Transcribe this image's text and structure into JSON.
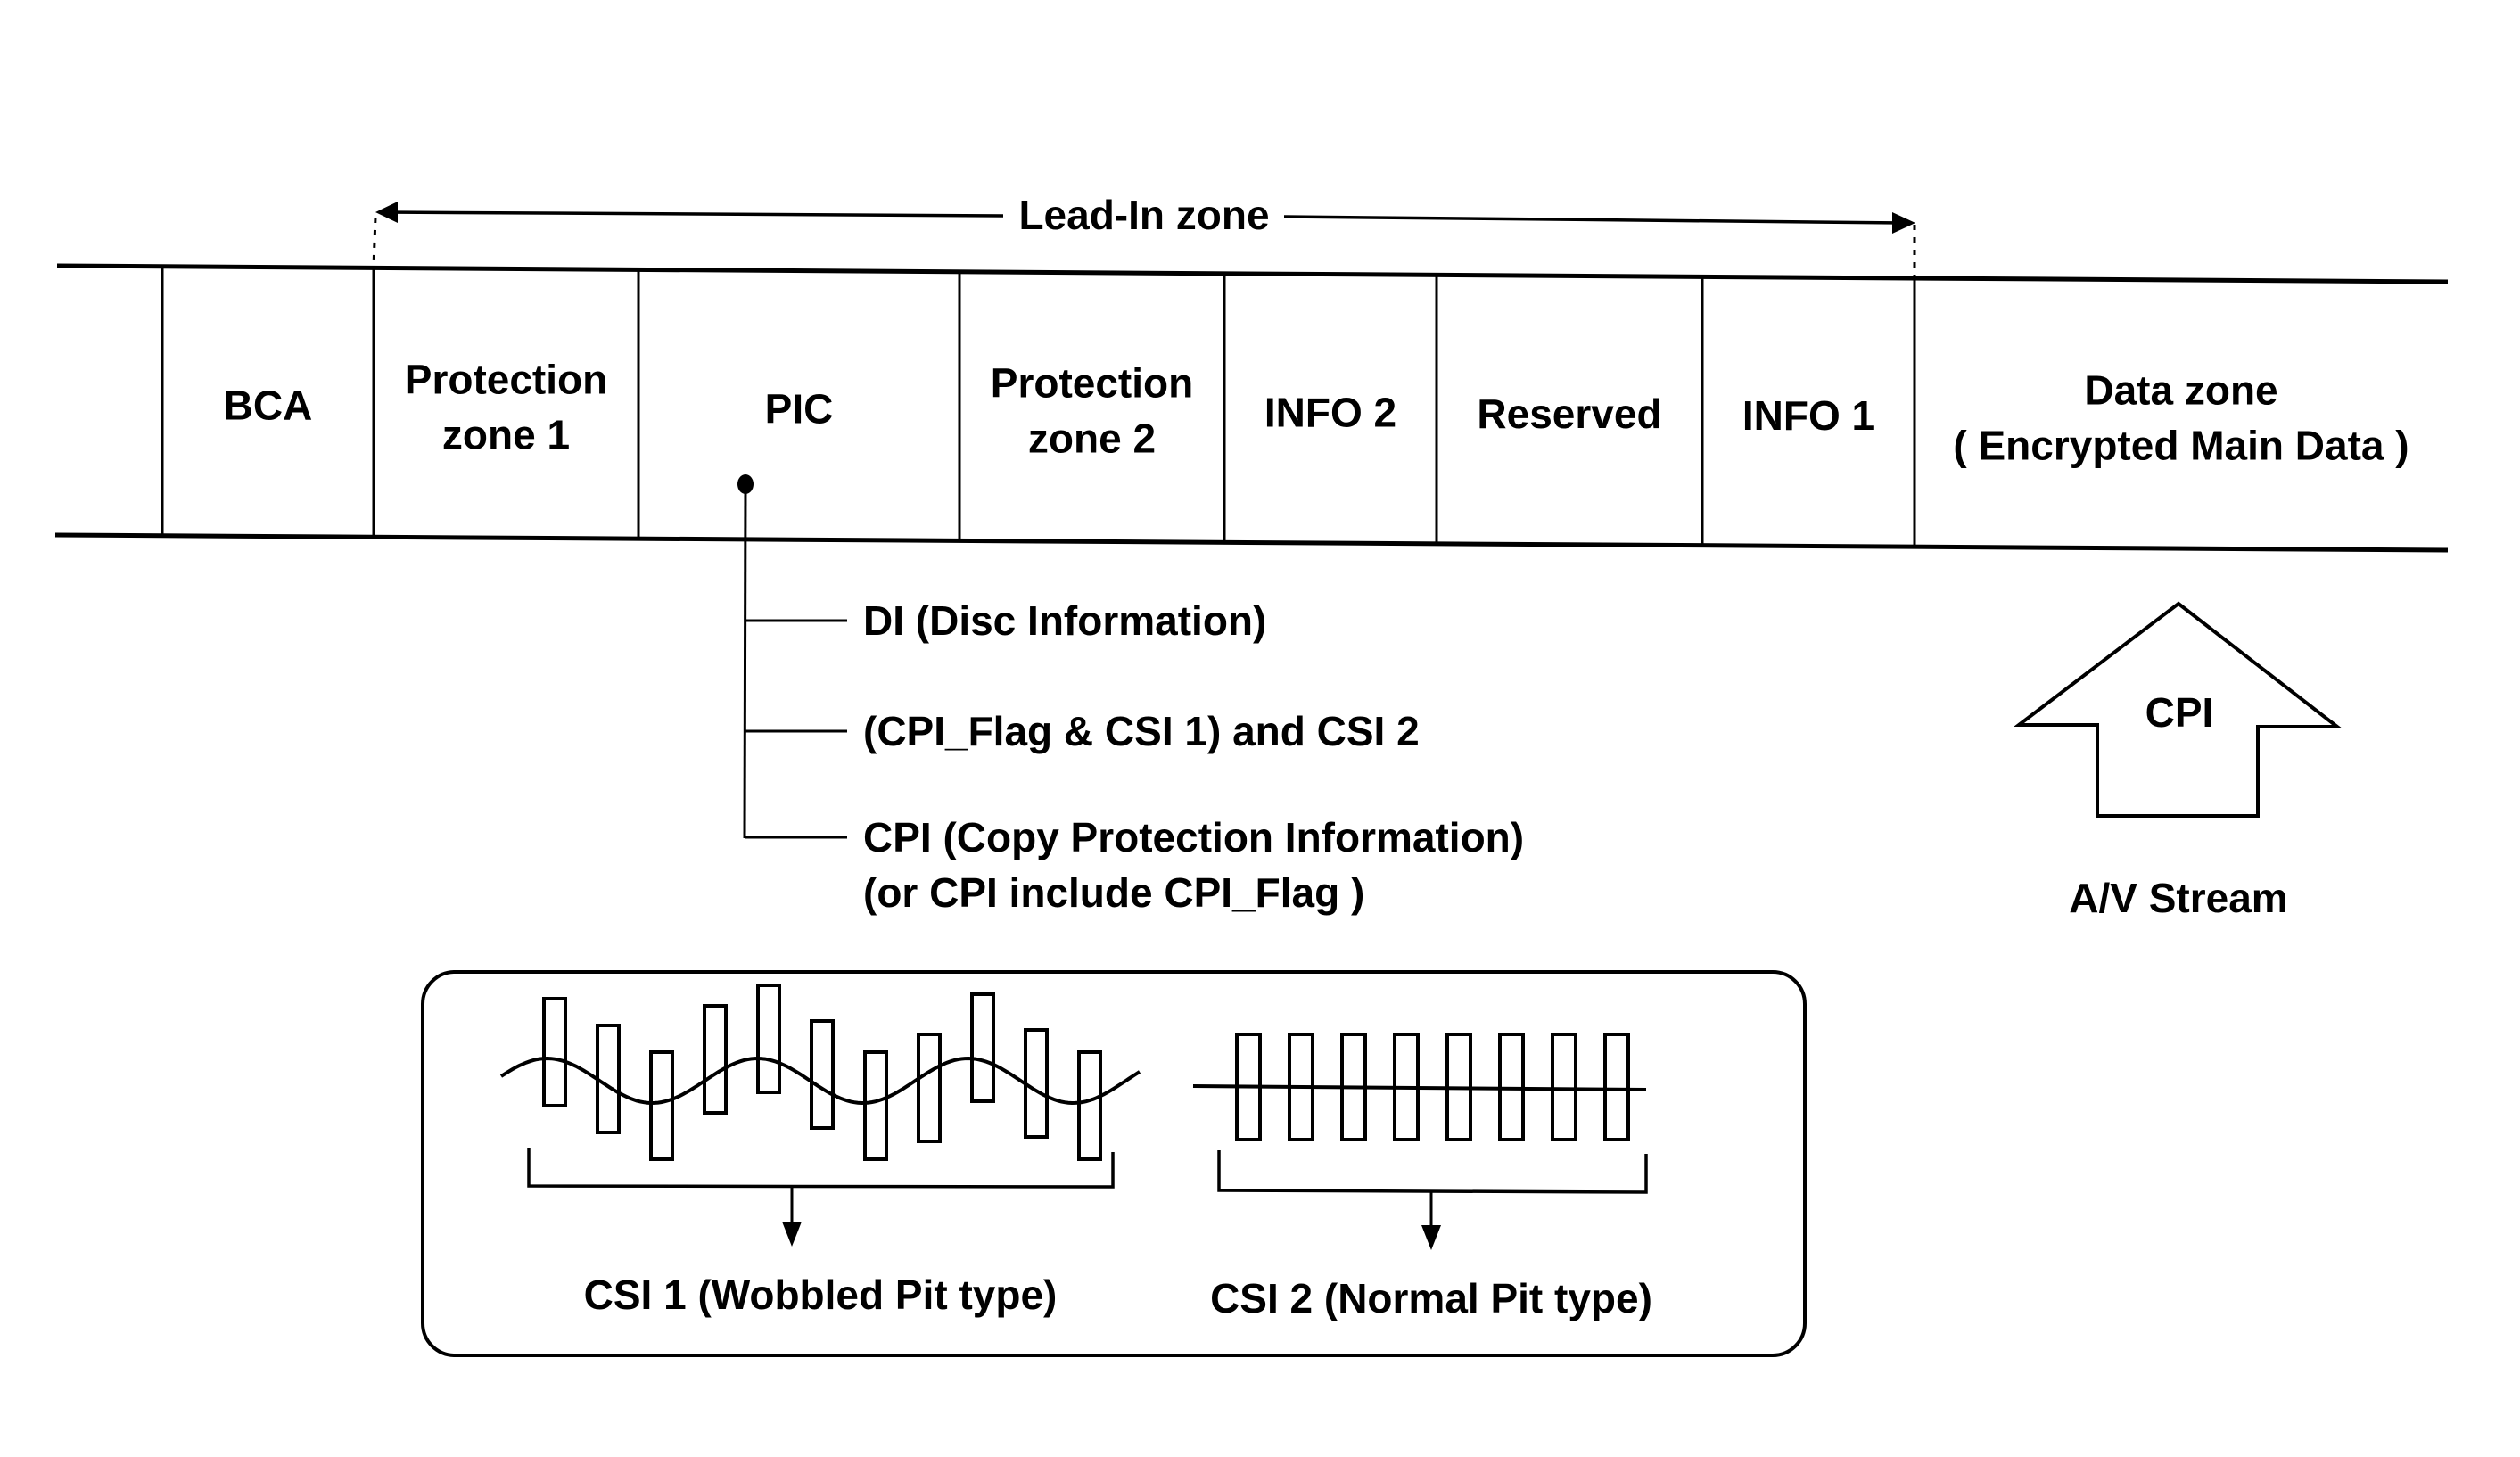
{
  "diagram": {
    "lead_in_label": "Lead-In zone",
    "zones": [
      {
        "id": "bca",
        "lines": [
          "BCA"
        ]
      },
      {
        "id": "protection-zone-1",
        "lines": [
          "Protection",
          "zone 1"
        ]
      },
      {
        "id": "pic",
        "lines": [
          "PIC"
        ]
      },
      {
        "id": "protection-zone-2",
        "lines": [
          "Protection",
          "zone 2"
        ]
      },
      {
        "id": "info-2",
        "lines": [
          "INFO 2"
        ]
      },
      {
        "id": "reserved",
        "lines": [
          "Reserved"
        ]
      },
      {
        "id": "info-1",
        "lines": [
          "INFO 1"
        ]
      },
      {
        "id": "data-zone",
        "lines": [
          "Data zone",
          "( Encrypted Main Data )"
        ]
      }
    ],
    "pic_contents": [
      {
        "lines": [
          "DI (Disc Information)"
        ]
      },
      {
        "lines": [
          "(CPI_Flag & CSI 1) and CSI 2"
        ]
      },
      {
        "lines": [
          "CPI (Copy Protection Information)",
          "(or CPI include CPI_Flag )"
        ]
      }
    ],
    "cpi_arrow": {
      "label": "CPI",
      "source_label": "A/V Stream"
    },
    "pit_types": {
      "csi1": {
        "label": "CSI 1 (Wobbled Pit type)",
        "pit_count": 11
      },
      "csi2": {
        "label": "CSI 2 (Normal Pit type)",
        "pit_count": 8
      }
    }
  }
}
